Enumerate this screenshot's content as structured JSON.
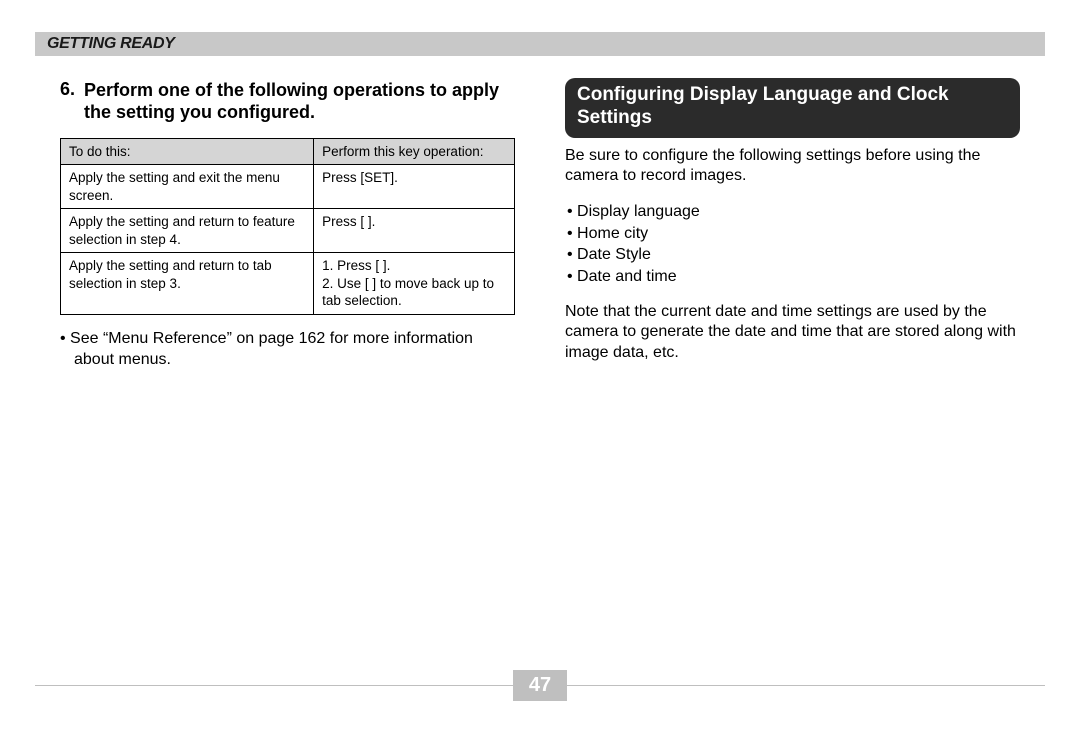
{
  "header": {
    "title": "Getting Ready"
  },
  "left": {
    "step_num": "6.",
    "step_text": "Perform one of the following operations to apply the setting you configured.",
    "table": {
      "headers": {
        "c1": "To do this:",
        "c2": "Perform this key operation:"
      },
      "rows": [
        {
          "c1": "Apply the setting and exit the menu screen.",
          "c2_lines": [
            "Press [SET]."
          ]
        },
        {
          "c1": "Apply the setting and return to feature selection in step 4.",
          "c2_lines": [
            "Press [   ]."
          ]
        },
        {
          "c1": "Apply the setting and return to tab selection in step 3.",
          "c2_lines": [
            "1.  Press [   ].",
            "2.  Use [   ] to move back up to tab selection."
          ]
        }
      ]
    },
    "note": "See “Menu Reference” on page 162 for more information about menus."
  },
  "right": {
    "section_title": "Configuring Display Language and Clock Settings",
    "intro": "Be sure to configure the following settings before using the camera to record images.",
    "bullets": [
      "Display language",
      "Home city",
      "Date Style",
      "Date and time"
    ],
    "note": "Note that the current date and time settings are used by the camera to generate the date and time that are stored along with image data, etc."
  },
  "page_number": "47"
}
